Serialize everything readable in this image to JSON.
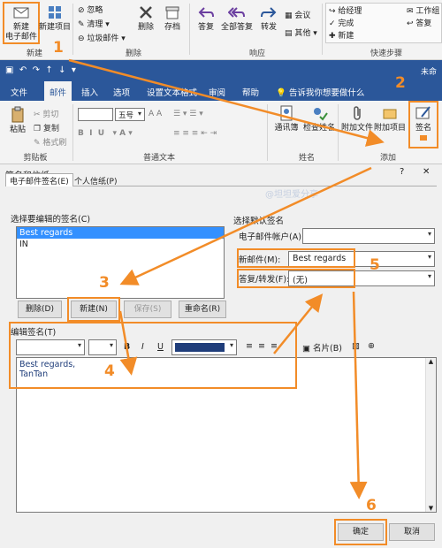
{
  "ribbon_top": {
    "new_email": "新建\n电子邮件",
    "new_items": "新建项目",
    "ignore": "忽略",
    "clean": "清理",
    "junk": "垃圾邮件",
    "delete": "删除",
    "archive": "存档",
    "reply": "答复",
    "reply_all": "全部答复",
    "forward": "转发",
    "meeting": "会议",
    "other": "其他",
    "quick_manager": "给经理",
    "quick_done": "完成",
    "quick_new": "新建",
    "quick_team": "工作组",
    "quick_reply_delete": "答复",
    "group_new": "新建",
    "group_delete": "删除",
    "group_respond": "响应",
    "group_quicksteps": "快速步骤"
  },
  "title_right": "未命",
  "tabs": [
    "文件",
    "邮件",
    "插入",
    "选项",
    "设置文本格式",
    "审阅",
    "帮助"
  ],
  "tell_me": "告诉我你想要做什么",
  "ribbon_main": {
    "paste": "粘贴",
    "cut": "剪切",
    "copy": "复制",
    "format_painter": "格式刷",
    "font_size": "五号",
    "address_book": "通讯簿",
    "check_names": "检查姓名",
    "attach_file": "附加文件",
    "attach_item": "附加项目",
    "signature": "签名",
    "group_clipboard": "剪贴板",
    "group_basic_text": "普通文本",
    "group_names": "姓名",
    "group_include": "添加"
  },
  "dialog": {
    "title": "签名和信纸",
    "help": "?",
    "close": "✕",
    "tab_email_sig": "电子邮件签名(E)",
    "tab_stationery": "个人信纸(P)",
    "select_sig_label": "选择要编辑的签名(C)",
    "sig_list": [
      "Best regards",
      "IN"
    ],
    "btn_delete": "删除(D)",
    "btn_new": "新建(N)",
    "btn_save": "保存(S)",
    "btn_rename": "重命名(R)",
    "default_sig_label": "选择默认签名",
    "account_label": "电子邮件帐户(A):",
    "account_value": "",
    "new_msg_label": "新邮件(M):",
    "new_msg_value": "Best regards",
    "reply_label": "答复/转发(F):",
    "reply_value": "(无)",
    "edit_sig_label": "编辑签名(T)",
    "business_card": "名片(B)",
    "sig_text_line1": "Best regards,",
    "sig_text_line2": "TanTan",
    "ok": "确定",
    "cancel": "取消",
    "watermark": "@坦坦爱分享"
  },
  "steps": [
    "1",
    "2",
    "3",
    "4",
    "5",
    "6"
  ],
  "colors": {
    "accent": "#2b579a",
    "annotation": "#f28c28",
    "font_color_swatch": "#1f3d7a"
  }
}
